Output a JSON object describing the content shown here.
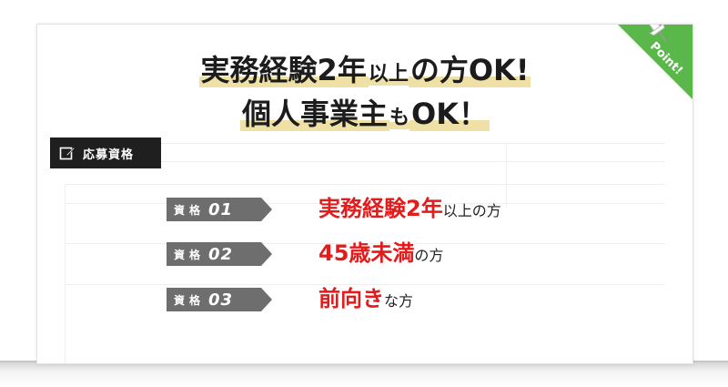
{
  "headline": {
    "line1_big_1": "実務経験2年",
    "line1_small": "以上",
    "line1_big_2": "の方OK!",
    "line2_big": "個人事業主",
    "line2_small": "も",
    "line2_big_2": "OK！"
  },
  "corner": {
    "label": "Point!",
    "icon": "pushpin-icon",
    "color": "#5ab84a"
  },
  "qualification": {
    "label": "応募資格",
    "icon": "edit-icon"
  },
  "requirements": [
    {
      "badge_label": "資格",
      "number": "01",
      "emphasis": "実務経験2年",
      "rest": "以上の方"
    },
    {
      "badge_label": "資格",
      "number": "02",
      "emphasis": "45歳未満",
      "rest": "の方"
    },
    {
      "badge_label": "資格",
      "number": "03",
      "emphasis": "前向き",
      "rest": "な方"
    }
  ],
  "colors": {
    "accent": "#e31b1b",
    "highlight": "#efe1a5",
    "badge": "#6e6e6e"
  }
}
